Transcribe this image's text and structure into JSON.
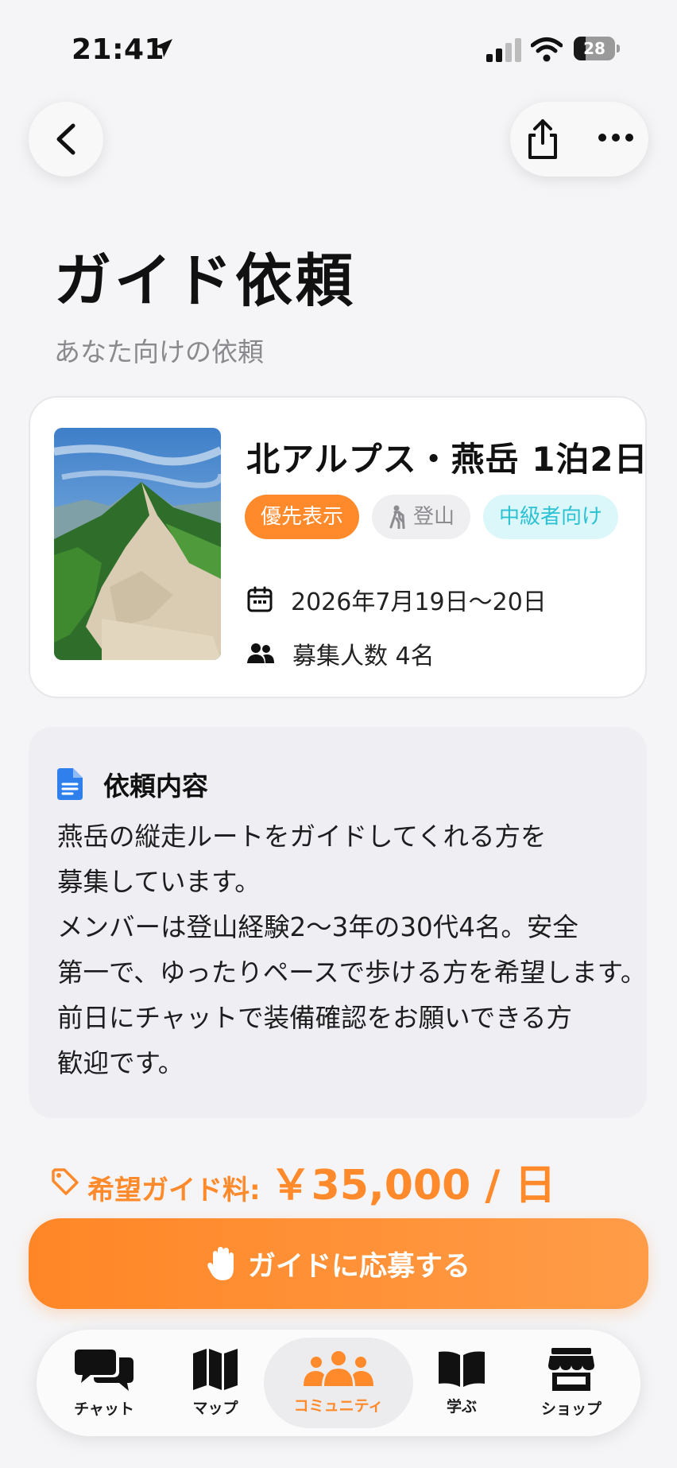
{
  "status_bar": {
    "time": "21:41",
    "battery": "28",
    "battery_level": 0.28
  },
  "header": {
    "title": "ガイド依頼",
    "subtitle": "あなた向けの依頼"
  },
  "request": {
    "title": "北アルプス・燕岳 1泊2日",
    "tags": {
      "priority": "優先表示",
      "category": "登山",
      "level": "中級者向け"
    },
    "date": "2026年7月19日〜20日",
    "people": "募集人数 4名"
  },
  "description": {
    "heading": "依頼内容",
    "lines": [
      "燕岳の縦走ルートをガイドしてくれる方を",
      "募集しています。",
      "メンバーは登山経験2〜3年の30代4名。安全",
      "第一で、ゆったりペースで歩ける方を希望します。",
      "前日にチャットで装備確認をお願いできる方",
      "歓迎です。"
    ]
  },
  "fee": {
    "label": "希望ガイド料:",
    "amount": "￥35,000 / 日"
  },
  "apply_button": {
    "label": "ガイドに応募する"
  },
  "tabs": [
    {
      "label": "チャット",
      "icon": "chat-bubbles-icon"
    },
    {
      "label": "マップ",
      "icon": "map-icon"
    },
    {
      "label": "コミュニティ",
      "icon": "people-icon"
    },
    {
      "label": "学ぶ",
      "icon": "book-icon"
    },
    {
      "label": "ショップ",
      "icon": "store-icon"
    }
  ],
  "colors": {
    "accent": "#FF8A2B",
    "level_tag_bg": "#DCF7F9",
    "level_tag_text": "#2CC2D3",
    "doc_icon": "#2F80ED"
  }
}
